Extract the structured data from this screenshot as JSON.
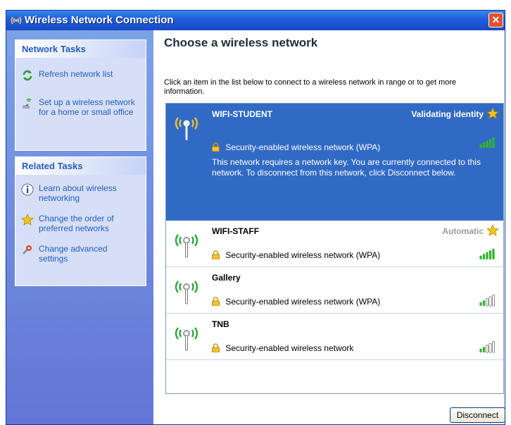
{
  "window": {
    "title": "Wireless Network Connection",
    "close_label": "✕"
  },
  "sidebar": {
    "network_tasks": {
      "header": "Network Tasks",
      "items": [
        {
          "label": "Refresh network list",
          "icon": "refresh-icon"
        },
        {
          "label": "Set up a wireless network for a home or small office",
          "icon": "setup-wizard-icon"
        }
      ]
    },
    "related_tasks": {
      "header": "Related Tasks",
      "items": [
        {
          "label": "Learn about wireless networking",
          "icon": "info-icon"
        },
        {
          "label": "Change the order of preferred networks",
          "icon": "star-icon"
        },
        {
          "label": "Change advanced settings",
          "icon": "settings-icon"
        }
      ]
    }
  },
  "main": {
    "heading": "Choose a wireless network",
    "instructions": "Click an item in the list below to connect to a wireless network in range or to get more information.",
    "networks": [
      {
        "name": "WIFI-STUDENT",
        "status": "Validating identity",
        "security": "Security-enabled wireless network (WPA)",
        "description": "This network requires a network key. You are currently connected to this network. To disconnect from this network, click Disconnect below.",
        "signal_bars": 5,
        "selected": true
      },
      {
        "name": "WIFI-STAFF",
        "status": "Automatic",
        "security": "Security-enabled wireless network (WPA)",
        "signal_bars": 5,
        "selected": false
      },
      {
        "name": "Gallery",
        "status": "",
        "security": "Security-enabled wireless network (WPA)",
        "signal_bars": 2,
        "selected": false
      },
      {
        "name": "TNB",
        "status": "",
        "security": "Security-enabled wireless network",
        "signal_bars": 2,
        "selected": false
      }
    ],
    "disconnect_label": "Disconnect"
  },
  "colors": {
    "title_bar": "#1f5fde",
    "selected_row": "#316ac5",
    "task_link": "#215dc6",
    "signal_on": "#2fb52f",
    "signal_off": "#ffffff",
    "star": "#f5c518"
  }
}
